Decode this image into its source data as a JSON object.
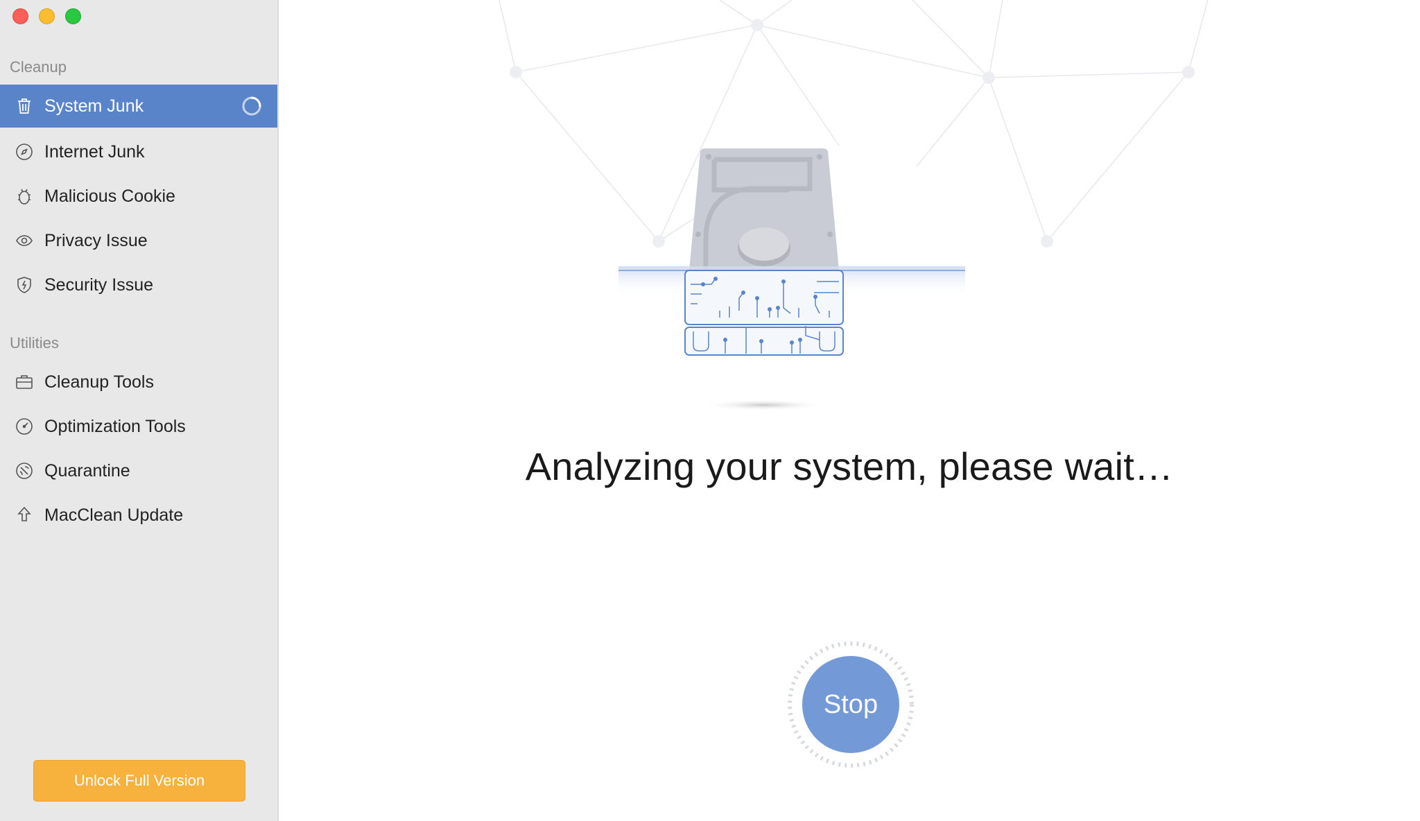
{
  "window": {
    "traffic_lights": {
      "close": "#fc5f57",
      "minimize": "#fdbc2e",
      "maximize": "#28c840"
    }
  },
  "sidebar": {
    "cleanup_label": "Cleanup",
    "utilities_label": "Utilities",
    "cleanup_items": [
      {
        "label": "System Junk",
        "icon": "trash-icon",
        "active": true,
        "loading": true
      },
      {
        "label": "Internet Junk",
        "icon": "compass-icon",
        "active": false
      },
      {
        "label": "Malicious Cookie",
        "icon": "bug-icon",
        "active": false
      },
      {
        "label": "Privacy Issue",
        "icon": "eye-icon",
        "active": false
      },
      {
        "label": "Security Issue",
        "icon": "shield-icon",
        "active": false
      }
    ],
    "utility_items": [
      {
        "label": "Cleanup Tools",
        "icon": "toolbox-icon"
      },
      {
        "label": "Optimization Tools",
        "icon": "gauge-icon"
      },
      {
        "label": "Quarantine",
        "icon": "quarantine-icon"
      },
      {
        "label": "MacClean Update",
        "icon": "upload-arrow-icon"
      }
    ],
    "unlock_button": "Unlock Full Version"
  },
  "main": {
    "status_text": "Analyzing your system, please wait…",
    "stop_button": "Stop",
    "illustration": "hard-drive-scan-icon"
  },
  "colors": {
    "accent": "#5a84c9",
    "stop_button": "#7399d6",
    "unlock_button": "#f7b23e",
    "sidebar_bg": "#e8e8e8"
  }
}
